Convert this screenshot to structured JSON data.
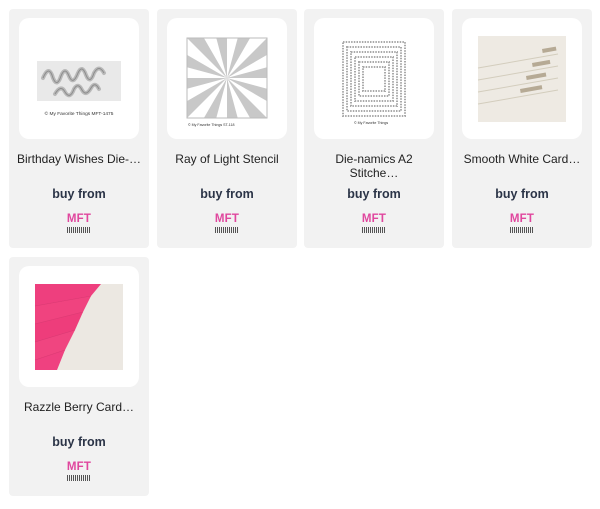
{
  "products": [
    {
      "title": "Birthday Wishes Die-…",
      "buy_label": "buy from",
      "vendor": "MFT",
      "image": "birthday-wishes-die-image",
      "image_caption": "© My Favorite Things MFT-1475"
    },
    {
      "title": "Ray of Light Stencil",
      "buy_label": "buy from",
      "vendor": "MFT",
      "image": "ray-of-light-stencil-image",
      "image_caption": "© My Favorite Things ST-118"
    },
    {
      "title": "Die-namics A2 Stitche…",
      "buy_label": "buy from",
      "vendor": "MFT",
      "image": "a2-stitched-rectangle-dies-image",
      "image_caption": "© My Favorite Things"
    },
    {
      "title": "Smooth White Card…",
      "buy_label": "buy from",
      "vendor": "MFT",
      "image": "smooth-white-cardstock-image"
    },
    {
      "title": "Razzle Berry Card…",
      "buy_label": "buy from",
      "vendor": "MFT",
      "image": "razzle-berry-cardstock-image"
    }
  ],
  "colors": {
    "card_bg": "#f2f2f2",
    "buy_text": "#2b3447",
    "vendor_logo": "#e0479e",
    "razzle_berry": "#f0407f"
  }
}
